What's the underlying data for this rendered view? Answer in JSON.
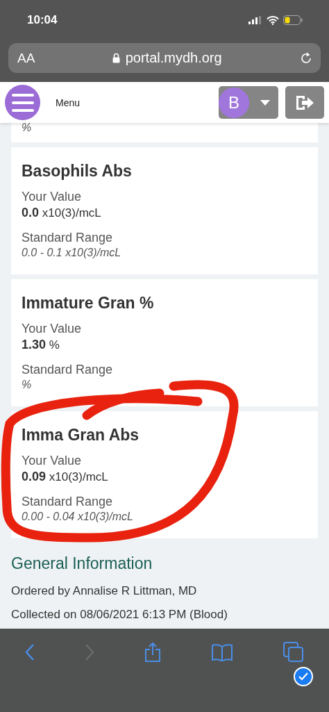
{
  "status_bar": {
    "time": "10:04"
  },
  "address_bar": {
    "text_size": "AA",
    "url": "portal.mydh.org"
  },
  "header": {
    "menu_label": "Menu",
    "avatar": "B"
  },
  "results": [
    {
      "range": "%"
    },
    {
      "name": "Basophils Abs",
      "value_label": "Your Value",
      "value": "0.0",
      "unit": "x10(3)/mcL",
      "range_label": "Standard Range",
      "range": "0.0 - 0.1 x10(3)/mcL"
    },
    {
      "name": "Immature Gran %",
      "value_label": "Your Value",
      "value": "1.30",
      "unit": "%",
      "range_label": "Standard Range",
      "range": "%"
    },
    {
      "name": "Imma Gran Abs",
      "value_label": "Your Value",
      "value": "0.09",
      "unit": "x10(3)/mcL",
      "range_label": "Standard Range",
      "range": "0.00 - 0.04 x10(3)/mcL"
    }
  ],
  "general": {
    "heading": "General Information",
    "lines": [
      "Ordered by Annalise R Littman, MD",
      "Collected on 08/06/2021 6:13 PM (Blood)"
    ]
  },
  "toolbar": [
    {
      "kind": "back",
      "disabled": false
    },
    {
      "kind": "forward",
      "disabled": true
    },
    {
      "kind": "share",
      "disabled": false
    },
    {
      "kind": "bookmarks",
      "disabled": false
    },
    {
      "kind": "tabs",
      "disabled": false
    }
  ]
}
